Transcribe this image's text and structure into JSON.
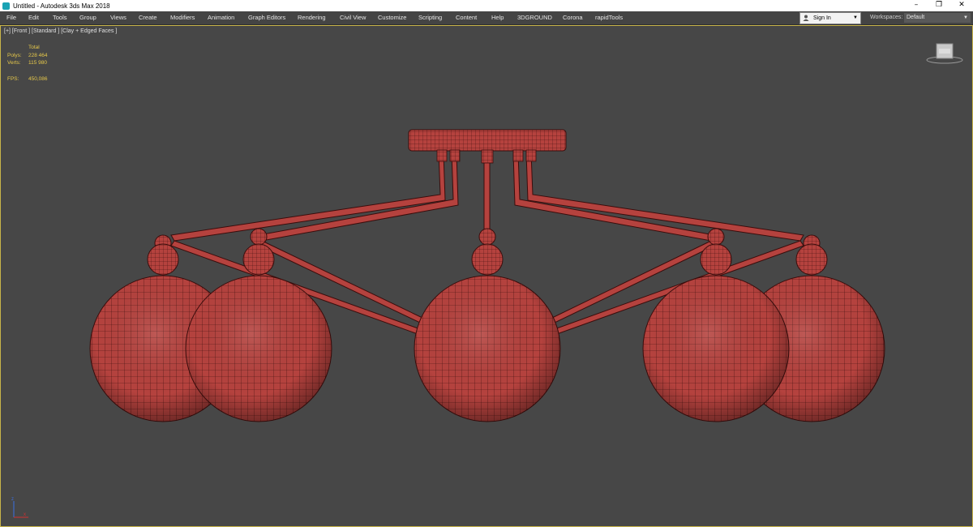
{
  "window": {
    "title": "Untitled - Autodesk 3ds Max 2018",
    "controls": [
      "–",
      "❐",
      "✕"
    ]
  },
  "menu": {
    "items": [
      "File",
      "Edit",
      "Tools",
      "Group",
      "Views",
      "Create",
      "Modifiers",
      "Animation",
      "Graph Editors",
      "Rendering",
      "Civil View",
      "Customize",
      "Scripting",
      "Content",
      "Help",
      "3DGROUND",
      "Corona",
      "rapidTools"
    ],
    "signin": "Sign In",
    "workspaces_label": "Workspaces:",
    "workspace_value": "Default"
  },
  "viewport": {
    "label": "[+] [Front ] [Standard ] [Clay + Edged Faces ]",
    "stats": {
      "total_label": "Total",
      "polys_label": "Polys:",
      "polys_value": "228 464",
      "verts_label": "Verts:",
      "verts_value": "115 980",
      "fps_label": "FPS:",
      "fps_value": "450,086"
    },
    "colors": {
      "model": "#b5423e",
      "wire": "#3a0d0c",
      "frame": "#c8b44a",
      "stats": "#e6c84a"
    }
  }
}
